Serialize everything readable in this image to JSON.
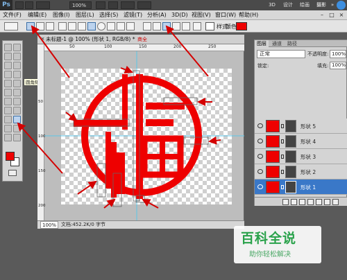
{
  "app": {
    "logo": "Ps",
    "zoom_display": "100%",
    "workspaces": [
      "3D",
      "设计",
      "绘画",
      "摄影",
      "»"
    ]
  },
  "menu": {
    "items": [
      "文件(F)",
      "编辑(E)",
      "图像(I)",
      "图层(L)",
      "选择(S)",
      "滤镜(T)",
      "分析(A)",
      "3D(D)",
      "视图(V)",
      "窗口(W)",
      "帮助(H)"
    ],
    "window_controls": [
      "–",
      "□",
      "×"
    ]
  },
  "options": {
    "style_label": "样式:",
    "color_label": "颜色:",
    "fill_color": "#ee0000"
  },
  "tools": {
    "tooltip": "圆角矩形工具 (U)",
    "foreground_color": "#ee0000",
    "background_color": "#ffffff"
  },
  "document": {
    "title": "未标题-1 @ 100% (形状 1, RGB/8) *",
    "ad_text": "商全",
    "zoom": "100%",
    "status": "文档:452.2K/0 字节",
    "ruler_top": [
      "50",
      "100",
      "150",
      "200",
      "250"
    ],
    "ruler_left": [
      "50",
      "100",
      "150",
      "200"
    ],
    "artwork_color": "#ee0000"
  },
  "layers": {
    "tabs": [
      "图层",
      "通道",
      "路径"
    ],
    "blend_mode": "正常",
    "opacity_label": "不透明度:",
    "opacity": "100%",
    "lock_label": "锁定:",
    "fill_label": "填充:",
    "fill": "100%",
    "items": [
      {
        "name": "形状 5",
        "selected": false
      },
      {
        "name": "形状 4",
        "selected": false
      },
      {
        "name": "形状 3",
        "selected": false
      },
      {
        "name": "形状 2",
        "selected": false
      },
      {
        "name": "形状 1",
        "selected": true
      }
    ]
  },
  "watermark": {
    "logo": "百科全说",
    "subtitle": "助你轻松解决"
  }
}
